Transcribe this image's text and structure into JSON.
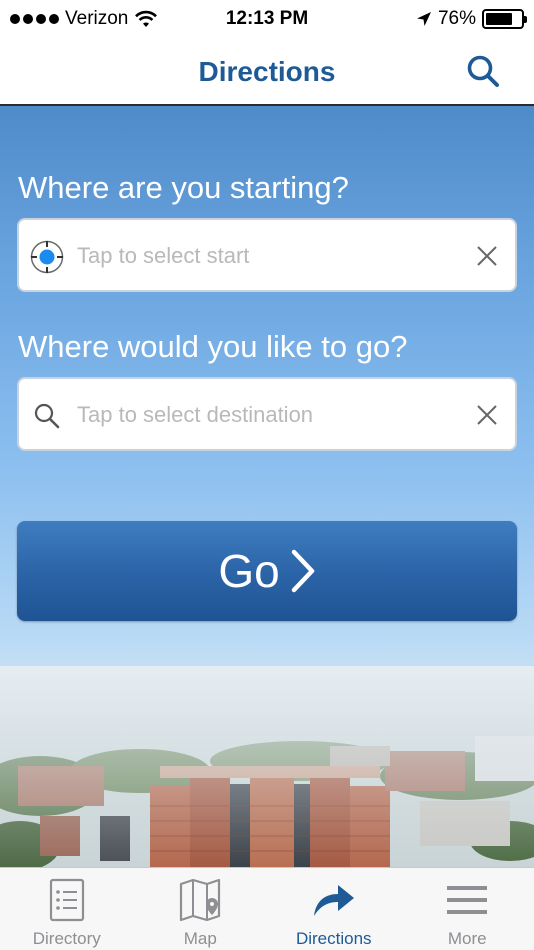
{
  "status_bar": {
    "carrier": "Verizon",
    "time": "12:13 PM",
    "battery_text": "76%",
    "battery_level": 0.76,
    "signal_bars": 4
  },
  "nav": {
    "title": "Directions",
    "search_icon": "search-icon"
  },
  "start": {
    "question": "Where are you starting?",
    "placeholder": "Tap to select start",
    "lead_icon": "locate-icon",
    "clear_icon": "clear-icon"
  },
  "destination": {
    "question": "Where would you like to go?",
    "placeholder": "Tap to select destination",
    "lead_icon": "search-icon",
    "clear_icon": "clear-icon"
  },
  "go_button": {
    "label": "Go",
    "icon": "chevron-right-icon"
  },
  "tabs": [
    {
      "label": "Directory",
      "icon": "directory-list-icon",
      "active": false
    },
    {
      "label": "Map",
      "icon": "map-icon",
      "active": false
    },
    {
      "label": "Directions",
      "icon": "directions-arrow-icon",
      "active": true
    },
    {
      "label": "More",
      "icon": "menu-icon",
      "active": false
    }
  ],
  "colors": {
    "accent": "#1e5a96",
    "go_button": "#2a63a6",
    "locate_dot": "#1a8cf0",
    "inactive_tab": "#8e8e93"
  }
}
